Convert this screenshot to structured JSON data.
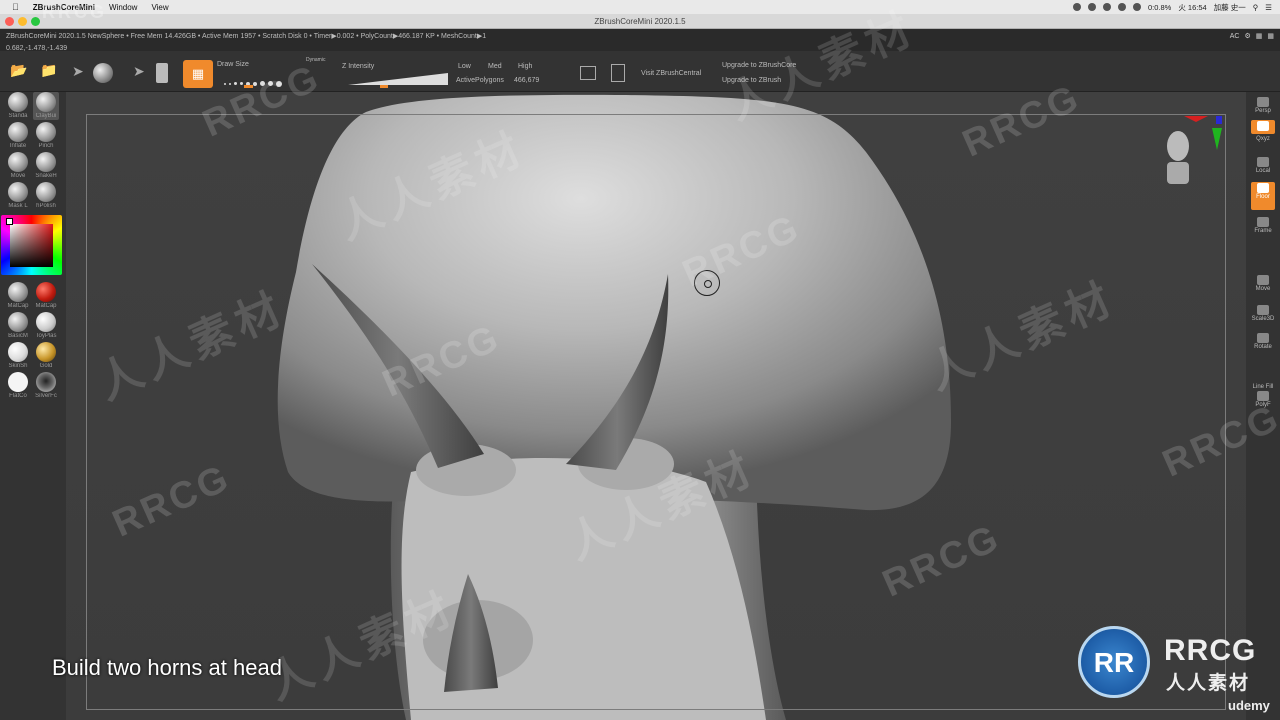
{
  "menubar": {
    "app_name": "ZBrushCoreMini",
    "menu_window": "Window",
    "menu_view": "View",
    "time": "火 16:54",
    "user": "加藤 史一",
    "battery": "0:0.8%"
  },
  "window": {
    "title": "ZBrushCoreMini 2020.1.5"
  },
  "infobar": {
    "line1": "ZBrushCoreMini 2020.1.5 NewSphere  • Free Mem 14.426GB • Active Mem 1957 • Scratch Disk 0 • Timer▶0.002 • PolyCount▶466.187 KP • MeshCount▶1",
    "line2": "0.682,-1.478,-1.439",
    "corner": "AC"
  },
  "toolbar": {
    "draw_size_label": "Draw Size",
    "dynamic_label": "Dynamic",
    "z_intensity_label": "Z Intensity",
    "res_low": "Low",
    "res_med": "Med",
    "res_high": "High",
    "active_polygons_label": "ActivePolygons",
    "active_polygons_value": "466,679",
    "visit_label": "Visit ZBrushCentral",
    "upgrade_core": "Upgrade to ZBrushCore",
    "upgrade_zbrush": "Upgrade to ZBrush"
  },
  "brushes": [
    {
      "label": "Standa"
    },
    {
      "label": "ClayBui"
    },
    {
      "label": "Inflate"
    },
    {
      "label": "Pinch"
    },
    {
      "label": "Move"
    },
    {
      "label": "SnakeH"
    },
    {
      "label": "Mask L"
    },
    {
      "label": "hPolish"
    }
  ],
  "materials": [
    {
      "label": "MatCap"
    },
    {
      "label": "MatCap"
    },
    {
      "label": "BasicM"
    },
    {
      "label": "ToyPlas"
    },
    {
      "label": "SkinSh"
    },
    {
      "label": "Gold"
    },
    {
      "label": "FlatCo"
    },
    {
      "label": "SilverFc"
    }
  ],
  "rightshelf": {
    "persp": "Persp",
    "gxyz": "Qxyz",
    "local": "Local",
    "floor": "Floor",
    "frame": "Frame",
    "move": "Move",
    "scale": "Scale3D",
    "rotate": "Rotate",
    "linefill": "Line Fill",
    "polyf": "PolyF"
  },
  "subtitle": "Build two horns at head",
  "watermark": {
    "latin": "RRCG",
    "cn": "人人素材"
  },
  "logo": {
    "mark": "RR",
    "name": "RRCG",
    "cn": "人人素材"
  },
  "udemy": "udemy",
  "colors": {
    "accent": "#f08a2c",
    "bg": "#3a3a3a"
  }
}
